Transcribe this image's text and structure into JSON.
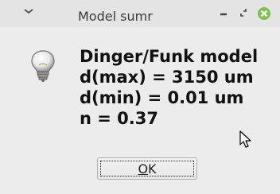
{
  "window": {
    "title": "Model sumr"
  },
  "titlebar_buttons": {
    "menu_icon": "chevron-down-icon",
    "minimize_icon": "minimize-icon",
    "restore_icon": "restore-icon",
    "close_icon": "close-icon",
    "close_color": "#7cc24a"
  },
  "message": {
    "icon": "lightbulb-icon",
    "lines": [
      "Dinger/Funk model",
      "d(max) = 3150 um",
      "d(min) = 0.01 um",
      "n = 0.37"
    ]
  },
  "ok_button": {
    "mnemonic": "O",
    "rest": "K"
  }
}
